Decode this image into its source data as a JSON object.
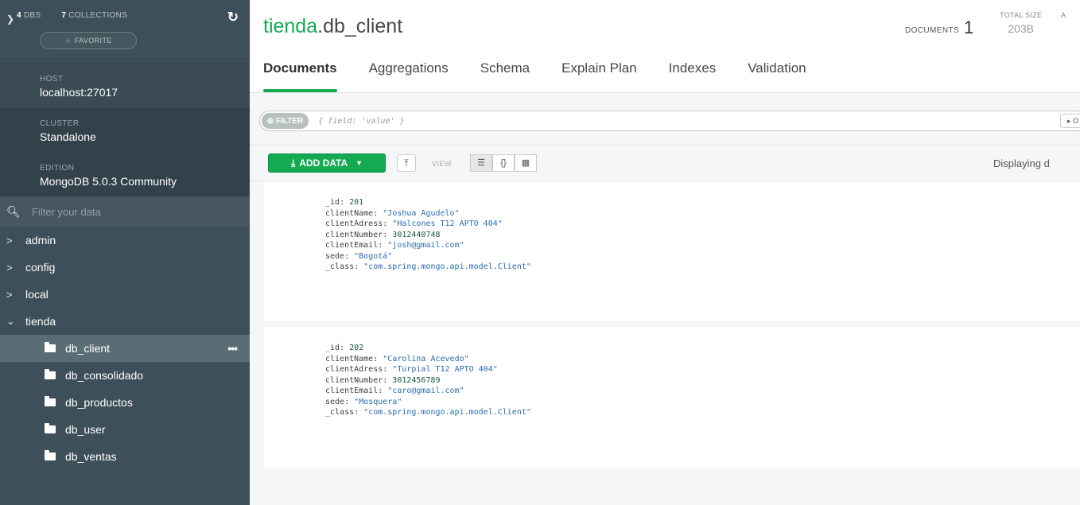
{
  "sidebar": {
    "dbs_count": "4",
    "dbs_label": "DBS",
    "collections_count": "7",
    "collections_label": "COLLECTIONS",
    "favorite_label": "FAVORITE",
    "info": [
      {
        "key": "HOST",
        "value": "localhost:27017"
      },
      {
        "key": "CLUSTER",
        "value": "Standalone"
      },
      {
        "key": "EDITION",
        "value": "MongoDB 5.0.3 Community"
      }
    ],
    "filter_placeholder": "Filter your data",
    "databases": [
      "admin",
      "config",
      "local",
      "tienda"
    ],
    "collections": [
      "db_client",
      "db_consolidado",
      "db_productos",
      "db_user",
      "db_ventas"
    ],
    "active_collection": "db_client"
  },
  "header": {
    "db_name": "tienda",
    "collection_name": ".db_client",
    "documents_label": "DOCUMENTS",
    "documents_value": "1",
    "total_size_label": "TOTAL SIZE",
    "total_size_value": "203B",
    "cut_label": "A"
  },
  "tabs": [
    "Documents",
    "Aggregations",
    "Schema",
    "Explain Plan",
    "Indexes",
    "Validation"
  ],
  "query": {
    "filter_label": "FILTER",
    "placeholder": "{ field: 'value' }",
    "options_label": "▸ O"
  },
  "toolbar": {
    "add_data_label": "ADD DATA",
    "view_label": "VIEW",
    "displaying_text": "Displaying d"
  },
  "documents": [
    {
      "fields": [
        {
          "key": "_id",
          "value": "201",
          "type": "num"
        },
        {
          "key": "clientName",
          "value": "\"Joshua Agudelo\"",
          "type": "str"
        },
        {
          "key": "clientAdress",
          "value": "\"Halcones T12 APTO 404\"",
          "type": "str"
        },
        {
          "key": "clientNumber",
          "value": "3012440748",
          "type": "num"
        },
        {
          "key": "clientEmail",
          "value": "\"josh@gmail.com\"",
          "type": "str"
        },
        {
          "key": "sede",
          "value": "\"Bogotá\"",
          "type": "str"
        },
        {
          "key": "_class",
          "value": "\"com.spring.mongo.api.model.Client\"",
          "type": "str"
        }
      ]
    },
    {
      "fields": [
        {
          "key": "_id",
          "value": "202",
          "type": "num"
        },
        {
          "key": "clientName",
          "value": "\"Carolina Acevedo\"",
          "type": "str"
        },
        {
          "key": "clientAdress",
          "value": "\"Turpial T12 APTO 404\"",
          "type": "str"
        },
        {
          "key": "clientNumber",
          "value": "3012456789",
          "type": "num"
        },
        {
          "key": "clientEmail",
          "value": "\"caro@gmail.com\"",
          "type": "str"
        },
        {
          "key": "sede",
          "value": "\"Mosquera\"",
          "type": "str"
        },
        {
          "key": "_class",
          "value": "\"com.spring.mongo.api.model.Client\"",
          "type": "str"
        }
      ]
    }
  ]
}
